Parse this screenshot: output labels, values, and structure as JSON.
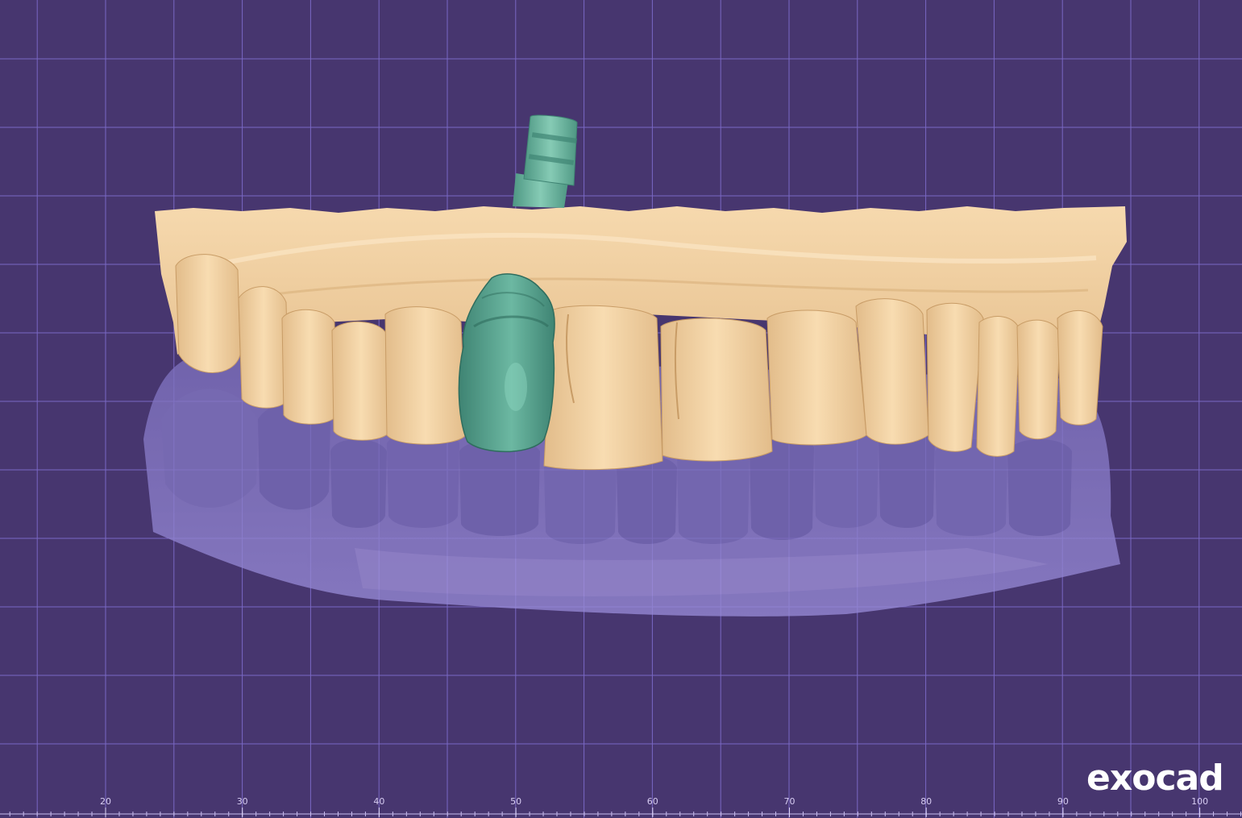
{
  "app": {
    "logo_text": "exocad"
  },
  "viewport": {
    "background_color": "#47366f",
    "grid_color": "#7a68c4",
    "ruler": {
      "labels": [
        "20",
        "30",
        "40",
        "50",
        "60",
        "70",
        "80",
        "90",
        "100"
      ],
      "minor_ticks_per_label": 10
    }
  },
  "scene": {
    "objects": [
      {
        "name": "upper-jaw-model",
        "color": "#f3d2a4",
        "opacity": 1.0
      },
      {
        "name": "lower-jaw-model",
        "color": "#8e80cc",
        "opacity": 0.75
      },
      {
        "name": "implant-crown",
        "color": "#4f9d88",
        "opacity": 1.0
      },
      {
        "name": "implant-abutment",
        "color": "#6fb9a3",
        "opacity": 1.0
      }
    ]
  }
}
